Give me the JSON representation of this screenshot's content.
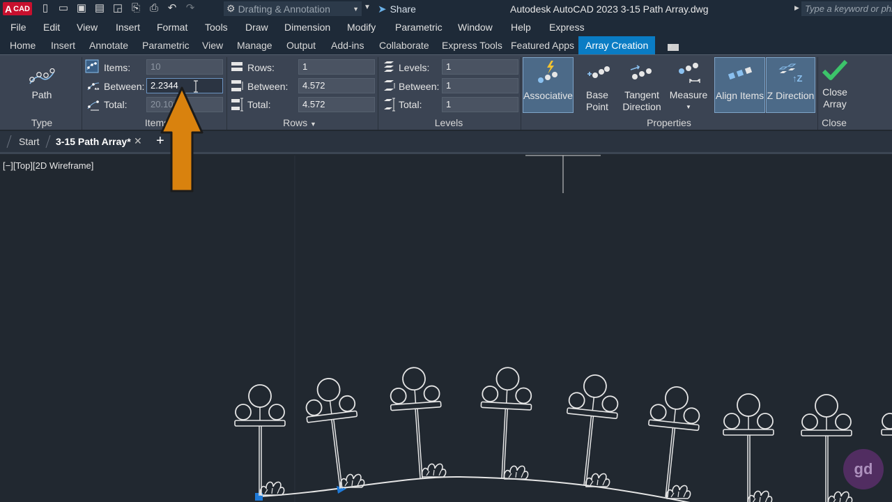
{
  "title_bar": {
    "logo_letter": "A",
    "logo_text": "CAD",
    "workspace": "Drafting & Annotation",
    "share": "Share",
    "app_title": "Autodesk AutoCAD 2023   3-15 Path Array.dwg",
    "search_placeholder": "Type a keyword or phrase"
  },
  "menu": [
    "File",
    "Edit",
    "View",
    "Insert",
    "Format",
    "Tools",
    "Draw",
    "Dimension",
    "Modify",
    "Parametric",
    "Window",
    "Help",
    "Express"
  ],
  "ribbon_tabs": [
    "Home",
    "Insert",
    "Annotate",
    "Parametric",
    "View",
    "Manage",
    "Output",
    "Add-ins",
    "Collaborate",
    "Express Tools",
    "Featured Apps",
    "Array Creation"
  ],
  "active_ribbon_tab": "Array Creation",
  "ribbon": {
    "type_panel": {
      "button": "Path",
      "title": "Type"
    },
    "items_panel": {
      "title": "Items",
      "items_label": "Items:",
      "items_value": "10",
      "between_label": "Between:",
      "between_value": "2.2344",
      "total_label": "Total:",
      "total_value": "20.1096"
    },
    "rows_panel": {
      "title": "Rows",
      "rows_label": "Rows:",
      "rows_value": "1",
      "between_label": "Between:",
      "between_value": "4.572",
      "total_label": "Total:",
      "total_value": "4.572"
    },
    "levels_panel": {
      "title": "Levels",
      "levels_label": "Levels:",
      "levels_value": "1",
      "between_label": "Between:",
      "between_value": "1",
      "total_label": "Total:",
      "total_value": "1"
    },
    "properties_panel": {
      "title": "Properties",
      "associative": "Associative",
      "base_point": "Base Point",
      "tangent_line1": "Tangent",
      "tangent_line2": "Direction",
      "measure": "Measure",
      "align_items": "Align Items",
      "z_direction": "Z Direction"
    },
    "close_panel": {
      "title": "Close",
      "close_line1": "Close",
      "close_line2": "Array"
    }
  },
  "doc_tabs": [
    "Start",
    "3-15 Path Array*"
  ],
  "viewport_label": "[−][Top][2D Wireframe]",
  "watermark": "gd",
  "colors": {
    "accent": "#0a7cc4",
    "arrow": "#d9820e",
    "close_check": "#3cc46a"
  }
}
